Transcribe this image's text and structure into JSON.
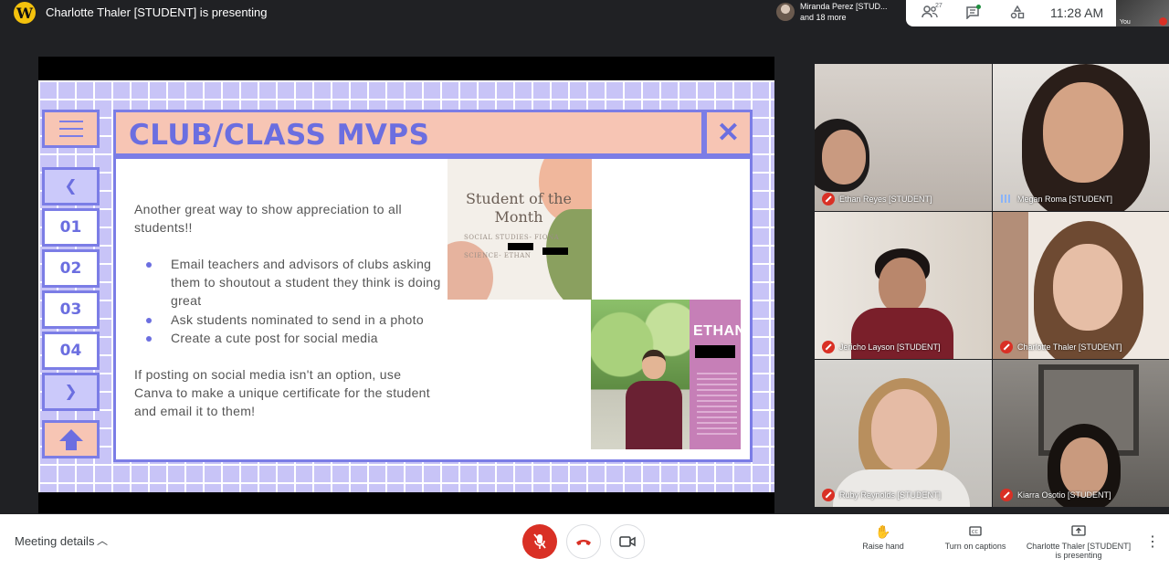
{
  "header": {
    "presenting_title": "Charlotte Thaler [STUDENT] is presenting",
    "people_name": "Miranda Perez [STUD...",
    "people_more": "and 18 more",
    "participant_count": "27",
    "clock": "11:28 AM",
    "self_label": "You"
  },
  "slide": {
    "title": "CLUB/CLASS MVPS",
    "nav_buttons": [
      "❮",
      "01",
      "02",
      "03",
      "04",
      "❯"
    ],
    "intro": "Another great way to show appreciation to all students!!",
    "bullets": [
      "Email teachers and advisors of clubs asking them to shoutout a student they think is doing great",
      "Ask students nominated to send in a photo",
      "Create a cute post for social media"
    ],
    "closing": "If posting on social media isn't an option, use Canva to make a unique certificate for the student and email it to them!",
    "photo1_title": "Student of the Month",
    "photo1_line1": "SOCIAL STUDIES- FIONA",
    "photo1_line2": "SCIENCE- ETHAN",
    "photo2_name": "ETHAN"
  },
  "participants": [
    {
      "name": "Ethan Reyes [STUDENT]",
      "mic": "muted"
    },
    {
      "name": "Megan Roma [STUDENT]",
      "mic": "speaking"
    },
    {
      "name": "Jericho Layson [STUDENT]",
      "mic": "muted"
    },
    {
      "name": "Charlotte Thaler [STUDENT]",
      "mic": "muted"
    },
    {
      "name": "Ruby Reynolds [STUDENT]",
      "mic": "muted"
    },
    {
      "name": "Kiarra Osotio [STUDENT]",
      "mic": "muted"
    }
  ],
  "footer": {
    "meeting_details": "Meeting details",
    "raise_hand": "Raise hand",
    "captions": "Turn on captions",
    "presenting_line1": "Charlotte Thaler [STUDENT]",
    "presenting_line2": "is presenting"
  },
  "colors": {
    "accent": "#6b6ee0",
    "slide_pink": "#f7c5b4",
    "slide_lavender": "#c8c4f7",
    "mute_red": "#d93025"
  }
}
